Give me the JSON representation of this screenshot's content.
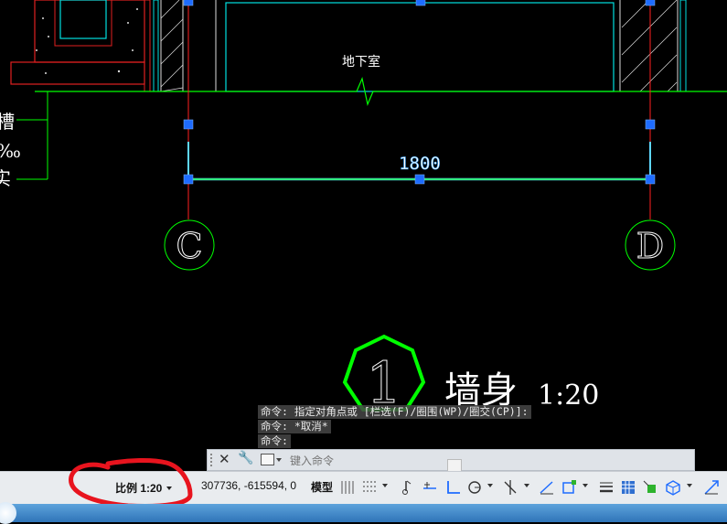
{
  "drawing": {
    "room_label": "地下室",
    "dimension_value": "1800",
    "axis_left": "C",
    "axis_right": "D",
    "detail_number": "1",
    "detail_title": "墙身",
    "detail_scale": "1:20",
    "left_notes": [
      "槽",
      "‰",
      "实"
    ]
  },
  "command_history": [
    "命令: 指定对角点或 [栏选(F)/圈围(WP)/圈交(CP)]:",
    "命令: *取消*",
    "命令:"
  ],
  "command_line": {
    "placeholder": "键入命令"
  },
  "status_bar": {
    "scale_label": "比例 1:20",
    "coordinates": "307736, -615594, 0",
    "model_label": "模型"
  },
  "colors": {
    "background": "#000000",
    "line_green": "#00ff00",
    "axis_red": "#ff2020",
    "grip_blue": "#1e6cff",
    "dimension_cyan": "#5fd7ff",
    "annotation_red": "#e8141e"
  }
}
